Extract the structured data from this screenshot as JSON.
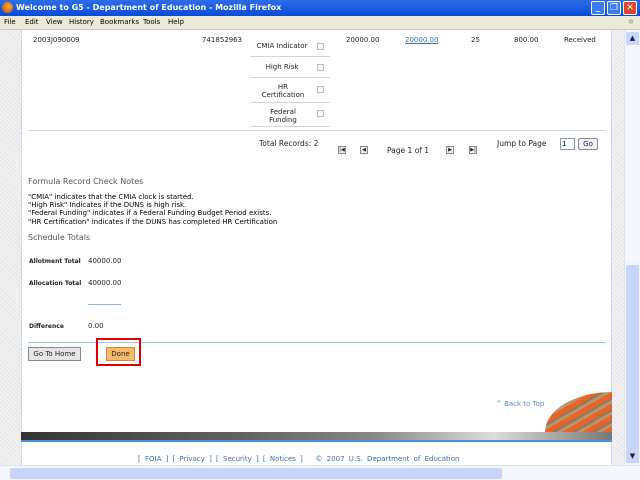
{
  "window": {
    "title": "Welcome to G5 - Department of Education - Mozilla Firefox"
  },
  "menu": [
    "File",
    "Edit",
    "View",
    "History",
    "Bookmarks",
    "Tools",
    "Help"
  ],
  "record": {
    "id": "2003J090009",
    "duns": "741852963",
    "allotment": "20000.00",
    "allocation": "20000.00",
    "col3": "25",
    "col4": "800.00",
    "status": "Received",
    "indicators": [
      {
        "label": "CMIA Indicator",
        "checked": false
      },
      {
        "label": "High Risk",
        "checked": false
      },
      {
        "label": "HR Certification",
        "checked": false
      },
      {
        "label": "Federal Funding",
        "checked": false
      }
    ]
  },
  "pager": {
    "total": "Total Records: 2",
    "page": "Page 1 of 1",
    "jump_label": "Jump to Page",
    "jump_value": "1",
    "go": "Go"
  },
  "notes": {
    "heading": "Formula Record Check Notes",
    "lines": [
      "\"CMIA\" indicates that the CMIA clock is started.",
      "\"High Risk\" Indicates if the DUNS is high risk.",
      "\"Federal Funding\" indicates if a Federal Funding Budget Period exists.",
      "\"HR Certification\" indicates if the DUNS has completed HR Certification"
    ]
  },
  "totals": {
    "heading": "Schedule Totals",
    "allotment_label": "Allotment Total",
    "allotment": "40000.00",
    "allocation_label": "Allocation Total",
    "allocation": "40000.00",
    "difference_label": "Difference",
    "difference": "0.00"
  },
  "buttons": {
    "home": "Go To Home",
    "done": "Done"
  },
  "back_to_top": "^ Back to Top",
  "footer": {
    "links": [
      "FOIA",
      "Privacy",
      "Security",
      "Notices"
    ],
    "copyright": "© 2007 U.S. Department of Education"
  },
  "colors": {
    "done": "#f7b96b",
    "highlight": "#e00000",
    "link": "#3b6ea8"
  }
}
